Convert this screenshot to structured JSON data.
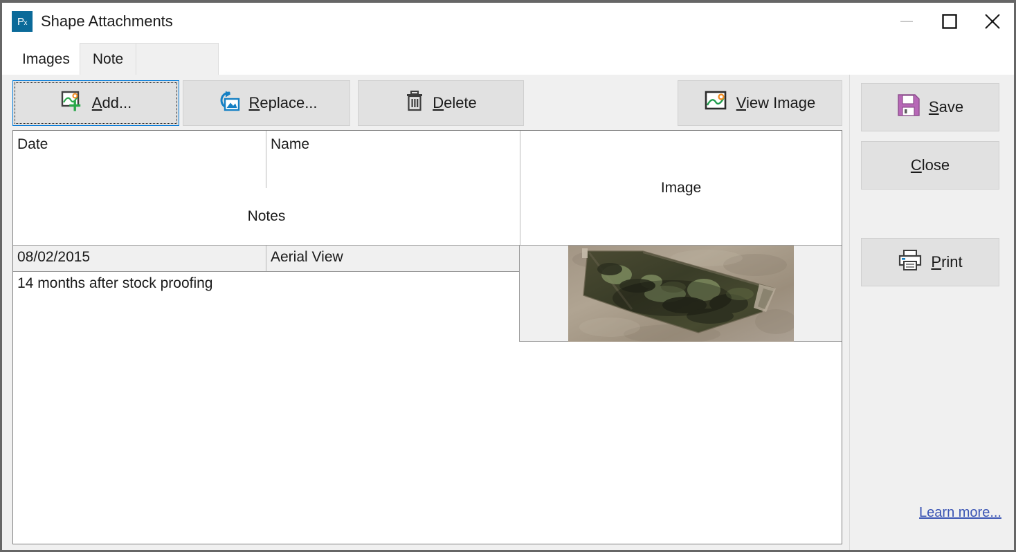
{
  "window": {
    "title": "Shape Attachments",
    "app_icon": "px-logo-icon",
    "controls": {
      "minimize": {
        "label": "Minimize",
        "icon": "minimize-icon",
        "enabled": false
      },
      "maximize": {
        "label": "Maximize",
        "icon": "maximize-icon",
        "enabled": true
      },
      "close": {
        "label": "Close",
        "icon": "close-icon",
        "enabled": true
      }
    }
  },
  "tabs": [
    {
      "label": "Images",
      "active": true
    },
    {
      "label": "Note",
      "active": false
    }
  ],
  "toolbar": {
    "add": {
      "label": "Add...",
      "accel": "A",
      "icon": "add-image-icon",
      "focused": true
    },
    "replace": {
      "label": "Replace...",
      "accel": "R",
      "icon": "replace-image-icon",
      "focused": false
    },
    "delete": {
      "label": "Delete",
      "accel": "D",
      "icon": "trash-icon",
      "focused": false
    },
    "view": {
      "label": "View Image",
      "accel": "V",
      "icon": "picture-icon",
      "focused": false
    }
  },
  "grid": {
    "headers": {
      "date": "Date",
      "name": "Name",
      "notes": "Notes",
      "image": "Image"
    },
    "rows": [
      {
        "date": "08/02/2015",
        "name": "Aerial View",
        "notes": "14 months after stock proofing",
        "image_alt": "aerial-photograph-thumbnail",
        "selected": true
      }
    ]
  },
  "sidebar": {
    "save": {
      "label": "Save",
      "accel": "S",
      "icon": "floppy-disk-icon"
    },
    "close": {
      "label": "Close",
      "accel": "C",
      "icon": null
    },
    "print": {
      "label": "Print",
      "accel": "P",
      "icon": "printer-icon"
    },
    "learn_more": "Learn more..."
  },
  "colors": {
    "accent_blue": "#0078d7",
    "title_icon_bg": "#0b6a99",
    "link": "#3a54b4",
    "save_icon": "#b768b7",
    "add_icon_green": "#2aa84a",
    "sun_orange": "#f08a1e",
    "hills_green": "#1f9c4d",
    "button_face": "#e1e1e1",
    "window_face": "#f0f0f0",
    "row_selected": "#f0f0f0"
  }
}
